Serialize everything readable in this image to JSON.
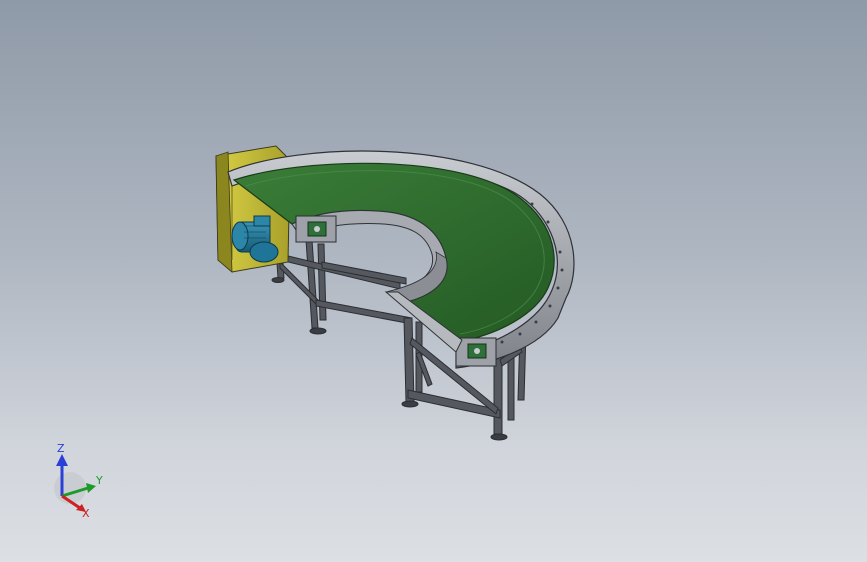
{
  "viewport": {
    "background_top": "#8f9aa8",
    "background_bottom": "#dcdfe3"
  },
  "model": {
    "belt_color": "#2e6b2e",
    "frame_color": "#8e9196",
    "motor_color": "#1f6f8f",
    "mount_plate_color": "#c9c23a"
  },
  "triad": {
    "z_label": "Z",
    "y_label": "Y",
    "x_label": "X",
    "z_color": "#2a3fd6",
    "y_color": "#1c9a2a",
    "x_color": "#cc2222"
  }
}
